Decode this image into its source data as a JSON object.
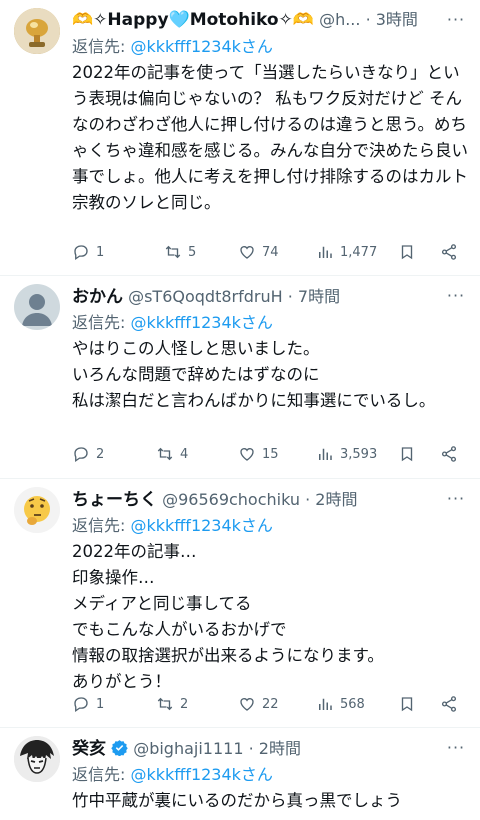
{
  "tweets": [
    {
      "name": "🫶✧Happy🩵Motohiko✧🫶",
      "handle": "@h...",
      "time": "· 3時間",
      "reply_prefix": "返信先: ",
      "reply_to": "@kkkfff1234kさん",
      "body": "2022年の記事を使って「当選したらいきなり」という表現は偏向じゃないの？ 私もワク反対だけど そんなのわざわざ他人に押し付けるのは違うと思う。めちゃくちゃ違和感を感じる。みんな自分で決めたら良い事でしょ。他人に考えを押し付け排除するのはカルト宗教のソレと同じ。",
      "stats": {
        "replies": "1",
        "retweets": "5",
        "likes": "74",
        "views": "1,477"
      },
      "avatar_icon": "golden-trophy-icon"
    },
    {
      "name": "おかん",
      "handle": "@sT6Qoqdt8rfdruH",
      "time": "· 7時間",
      "reply_prefix": "返信先: ",
      "reply_to": "@kkkfff1234kさん",
      "body": "やはりこの人怪しと思いました。\nいろんな問題で辞めたはずなのに\n私は潔白だと言わんばかりに知事選にでいるし。",
      "stats": {
        "replies": "2",
        "retweets": "4",
        "likes": "15",
        "views": "3,593"
      },
      "avatar_icon": "default-user-icon"
    },
    {
      "name": "ちょーちく",
      "handle": "@96569chochiku",
      "time": "· 2時間",
      "reply_prefix": "返信先: ",
      "reply_to": "@kkkfff1234kさん",
      "body": "2022年の記事…\n印象操作…\nメディアと同じ事してる\nでもこんな人がいるおかげで\n情報の取捨選択が出来るようになります。\nありがとう！",
      "stats": {
        "replies": "1",
        "retweets": "2",
        "likes": "22",
        "views": "568"
      },
      "avatar_icon": "thinking-face-icon"
    },
    {
      "name": "癸亥",
      "handle": "@bighaji1111",
      "time": "· 2時間",
      "reply_prefix": "返信先: ",
      "reply_to": "@kkkfff1234kさん",
      "body": "竹中平蔵が裏にいるのだから真っ黒でしょう",
      "avatar_icon": "manga-portrait-icon",
      "verified_icon": "verified-badge-icon"
    }
  ],
  "colors": {
    "text": "#0f1419",
    "muted": "#536471",
    "link": "#1d9bf0",
    "separator": "#eff3f4"
  }
}
